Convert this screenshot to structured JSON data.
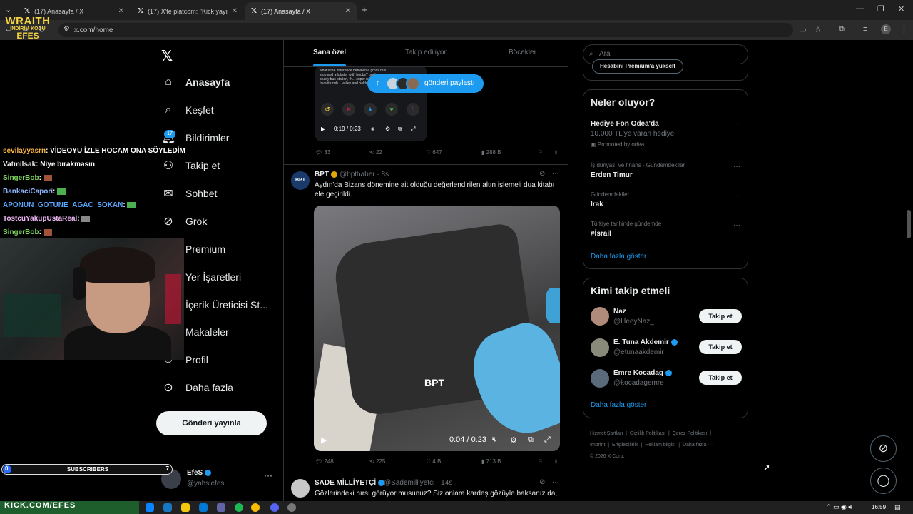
{
  "browser": {
    "tabs": [
      {
        "title": "(17) Anasayfa / X"
      },
      {
        "title": "(17) X'te platcom: \"Kick yayıncı"
      },
      {
        "title": "(17) Anasayfa / X"
      }
    ],
    "url": "x.com/home",
    "new_tab_symbol": "+",
    "profile_initial": "E"
  },
  "overlay": {
    "logo_line1": "WRAITH",
    "logo_line2": "İNDİRİM KODU",
    "logo_line3": "EFES",
    "chat": [
      {
        "user": "sevilayyasrn",
        "msg": ": VİDEOYU İZLE HOCAM ONA SÖYLEDİM",
        "color": "#f5b342"
      },
      {
        "user": "Vatmilsak",
        "msg": ": Niye bırakmasın",
        "color": "#e7e9ea"
      },
      {
        "user": "SingerBob",
        "msg": ":",
        "color": "#7cd35a"
      },
      {
        "user": "BankaciCapori",
        "msg": ":",
        "color": "#8fb8ff"
      },
      {
        "user": "APONUN_GOTUNE_AGAC_SOKAN",
        "msg": ":",
        "color": "#5aa7ff"
      },
      {
        "user": "TostcuYakupUstaReal",
        "msg": ":",
        "color": "#f0b7f5"
      },
      {
        "user": "SingerBob",
        "msg": ":",
        "color": "#7cd35a"
      }
    ],
    "subs_count": "0",
    "subs_label": "SUBSCRIBERS",
    "subs_goal": "7",
    "subs_progress": 0.05,
    "kick_url": "KICK.COM/EFES"
  },
  "nav": {
    "items": [
      {
        "label": "Anasayfa"
      },
      {
        "label": "Keşfet"
      },
      {
        "label": "Bildirimler"
      },
      {
        "label": "Takip et"
      },
      {
        "label": "Sohbet"
      },
      {
        "label": "Grok"
      },
      {
        "label": "Premium"
      },
      {
        "label": "Yer İşaretleri"
      },
      {
        "label": "İçerik Üreticisi St..."
      },
      {
        "label": "Makaleler"
      },
      {
        "label": "Profil"
      },
      {
        "label": "Daha fazla"
      }
    ],
    "notif_badge": "17",
    "post_button": "Gönderi yayınla",
    "profile_name": "EfeS",
    "profile_handle": "@yahslefes",
    "more": "···"
  },
  "feed": {
    "tabs": [
      "Sana özel",
      "Takip ediliyor",
      "Böcekler"
    ],
    "share_pill": "gönderi paylaştı",
    "embedded_text": "what's the difference between a gross bus stop and a lobster with boobs? one's a crusty bus station, th... super nerdy, my favorite cub... valley and baldurs gate 3",
    "embedded_time": "0:19 / 0:23",
    "tweet0_actions": {
      "replies": "33",
      "reposts": "22",
      "likes": "647",
      "views": "288 B"
    },
    "tweet1": {
      "avatar_text": "BPT",
      "name": "BPT",
      "handle": "@bpthaber",
      "time": "· 8s",
      "text": "Aydın'da Bizans dönemine ait olduğu değerlendirilen altın işlemeli dua kitabı ele geçirildi.",
      "video_watermark": "BPT",
      "video_time": "0:04 / 0:23",
      "actions": {
        "replies": "248",
        "reposts": "225",
        "likes": "4 B",
        "views": "713 B"
      }
    },
    "tweet2": {
      "name": "SADE MİLLİYETÇİ",
      "handle": "@Sademilliyetci",
      "time": "· 14s",
      "text": "Gözlerindeki hırsı görüyor musunuz? Siz onlara kardeş gözüyle baksanız da,"
    }
  },
  "right": {
    "search_placeholder": "Ara",
    "premium_chip": "Hesabını Premium'a yükselt",
    "trends_title": "Neler oluyor?",
    "trends": [
      {
        "context": "",
        "name": "Hediye Fon Odea'da",
        "sub": "10.000 TL'ye varan hediye",
        "promo": "Promoted by odea"
      },
      {
        "context": "İş dünyası ve finans · Gündemdekiler",
        "name": "Erden Timur",
        "sub": "",
        "promo": ""
      },
      {
        "context": "Gündemdekiler",
        "name": "Irak",
        "sub": "",
        "promo": ""
      },
      {
        "context": "Türkiye tarihinde gündemde",
        "name": "#İsrail",
        "sub": "",
        "promo": ""
      }
    ],
    "show_more": "Daha fazla göster",
    "follow_title": "Kimi takip etmeli",
    "follow": [
      {
        "name": "Naz",
        "handle": "@HeeyNaz_",
        "button": "Takip et",
        "verified": false
      },
      {
        "name": "E. Tuna Akdemir",
        "handle": "@etunaakdemir",
        "button": "Takip et",
        "verified": true
      },
      {
        "name": "Emre Kocadag",
        "handle": "@kocadagemre",
        "button": "Takip et",
        "verified": true
      }
    ],
    "footer": [
      "Hizmet Şartları",
      "Gizlilik Politikası",
      "Çerez Politikası",
      "Imprint",
      "Erişilebilirlik",
      "Reklam bilgisi",
      "Daha fazla ···",
      "© 2026 X Corp."
    ]
  },
  "taskbar": {
    "clock": "16:59"
  }
}
